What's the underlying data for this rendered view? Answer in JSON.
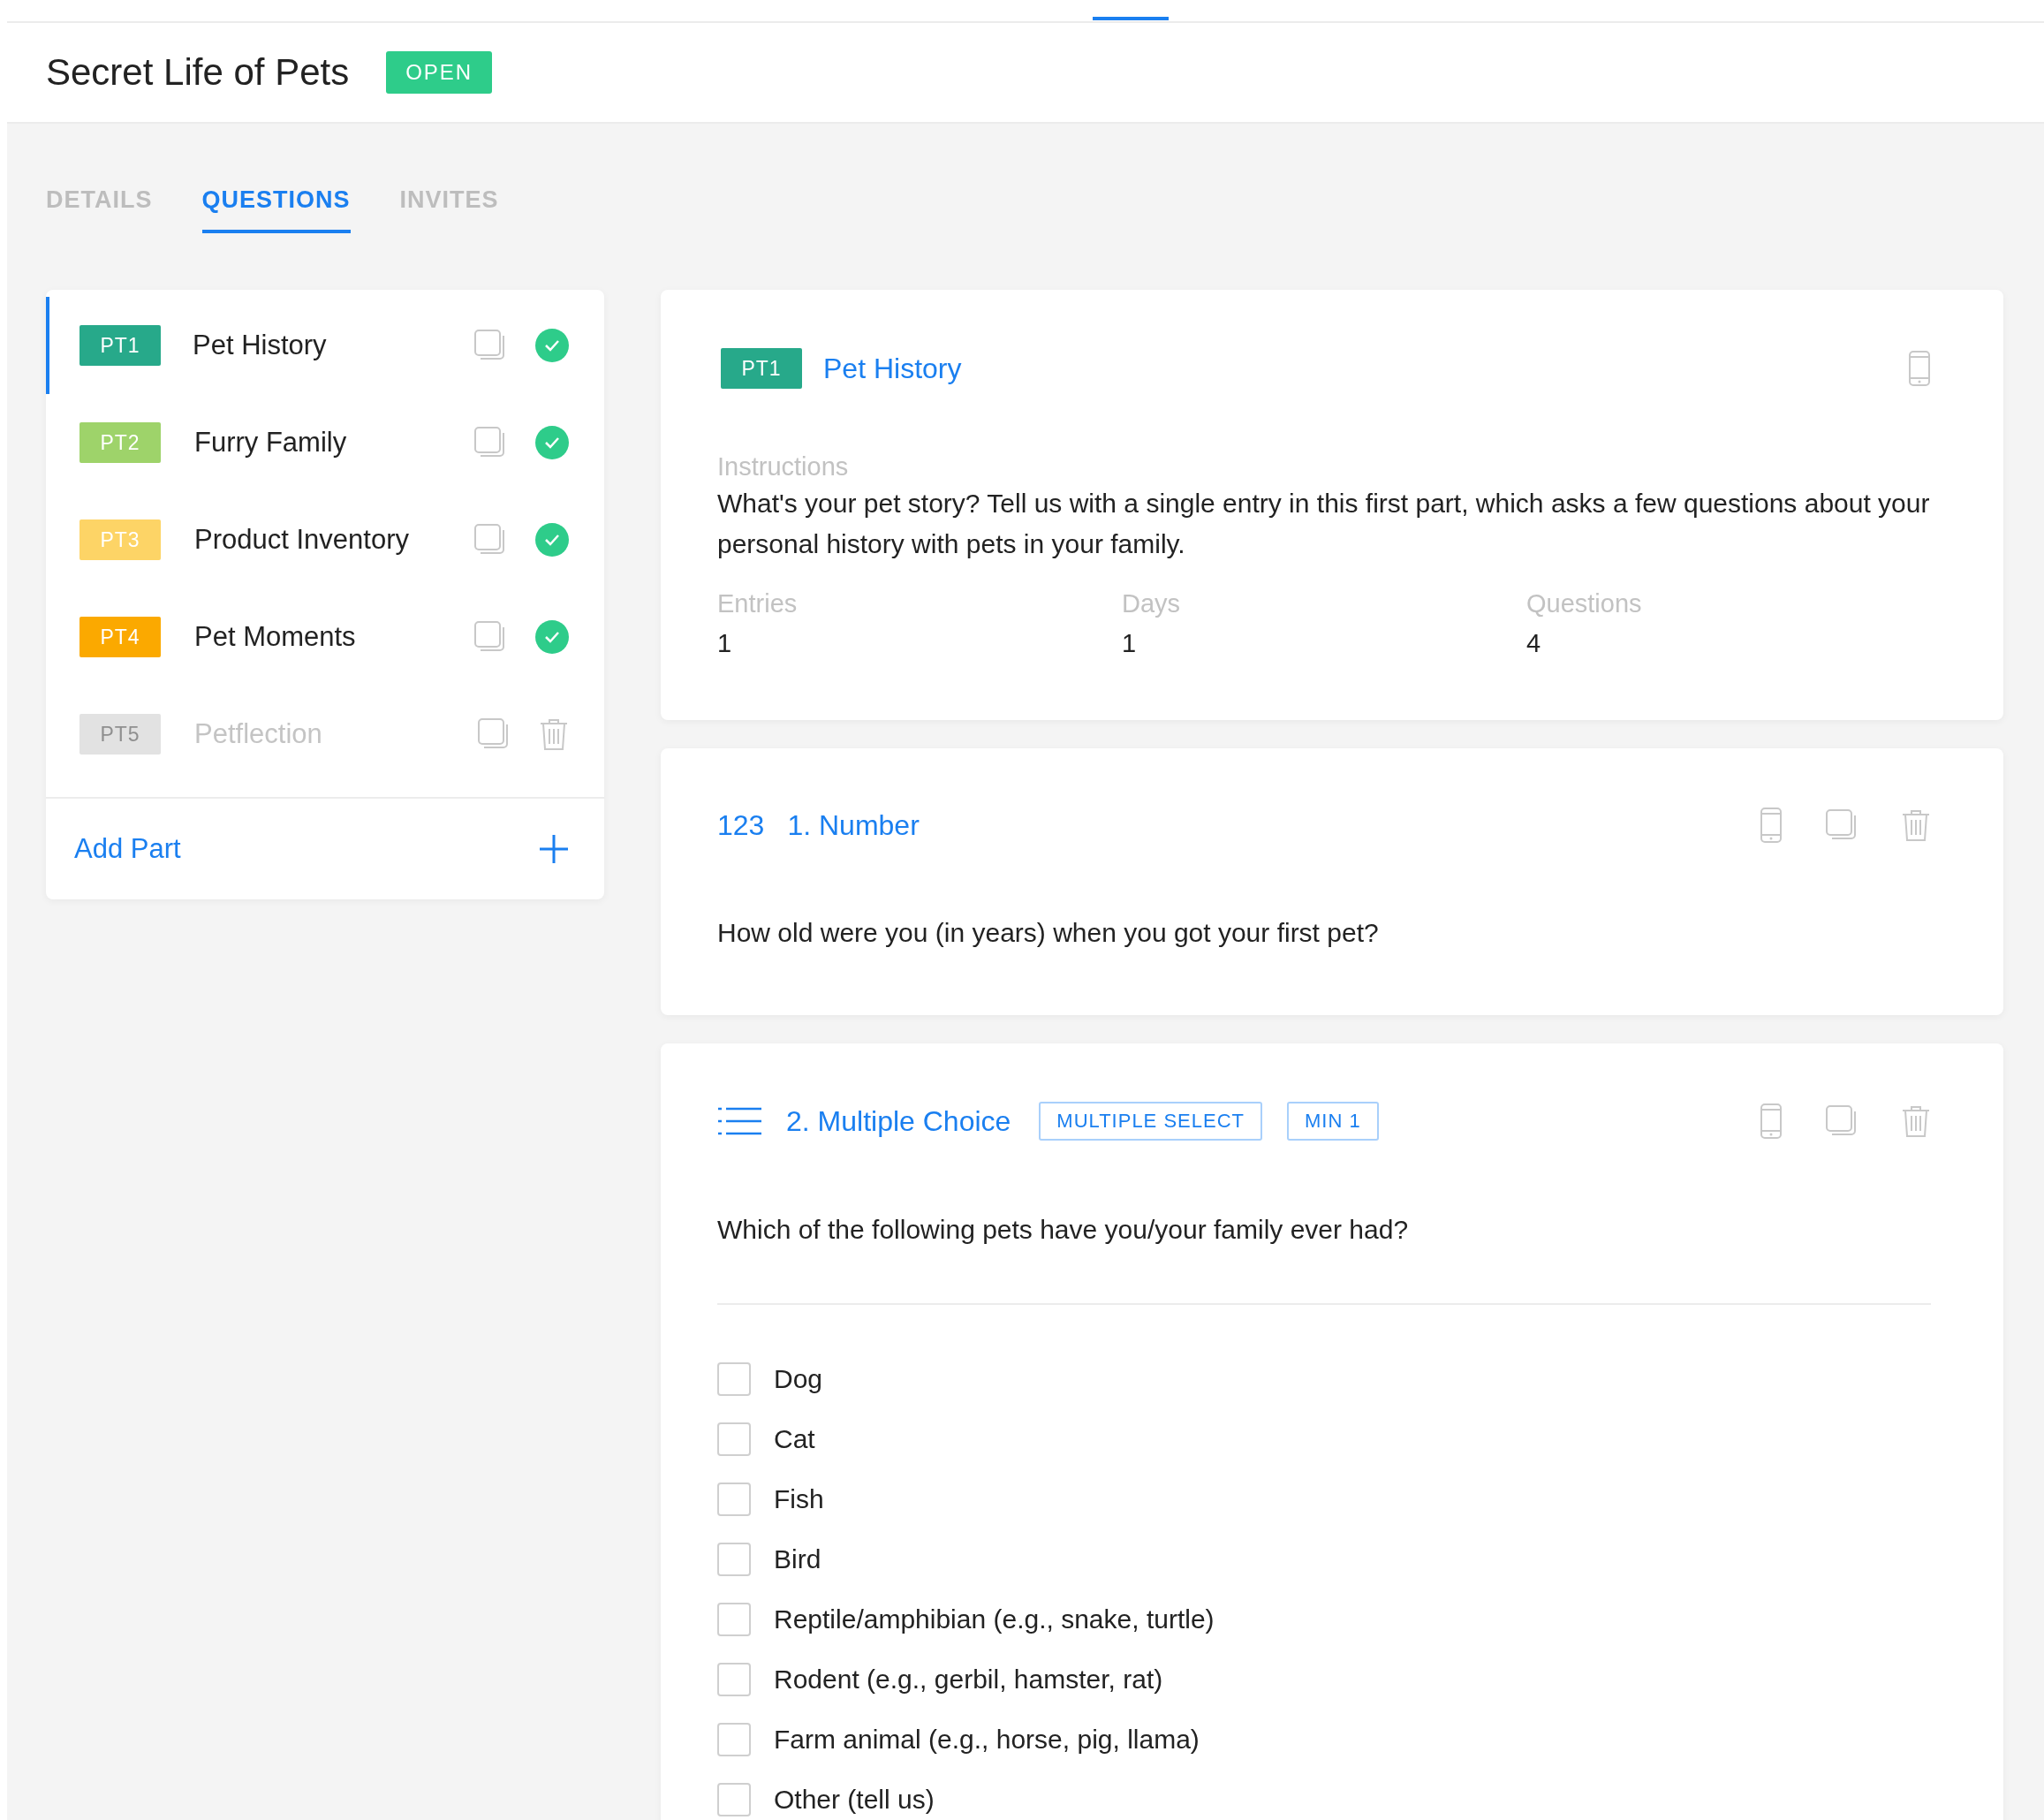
{
  "header": {
    "title": "Secret Life of Pets",
    "status": "OPEN"
  },
  "tabs": [
    {
      "label": "DETAILS",
      "selected": false
    },
    {
      "label": "QUESTIONS",
      "selected": true
    },
    {
      "label": "INVITES",
      "selected": false
    }
  ],
  "parts": [
    {
      "code": "PT1",
      "name": "Pet History",
      "color": "#27a98a",
      "selected": true,
      "disabled": false,
      "kind": "done"
    },
    {
      "code": "PT2",
      "name": "Furry Family",
      "color": "#9ed36a",
      "selected": false,
      "disabled": false,
      "kind": "done"
    },
    {
      "code": "PT3",
      "name": "Product Inventory",
      "color": "#fdd466",
      "selected": false,
      "disabled": false,
      "kind": "done"
    },
    {
      "code": "PT4",
      "name": "Pet Moments",
      "color": "#fba900",
      "selected": false,
      "disabled": false,
      "kind": "done"
    },
    {
      "code": "PT5",
      "name": "Petflection",
      "color": "#e2e2e2",
      "selected": false,
      "disabled": true,
      "kind": "deletable"
    }
  ],
  "add_part": "Add Part",
  "part_detail": {
    "code": "PT1",
    "color": "#27a98a",
    "name": "Pet History",
    "instructions_label": "Instructions",
    "instructions": "What's your pet story? Tell us with a single entry in this first part, which asks a few questions about your personal history with pets in your family.",
    "stats": [
      {
        "label": "Entries",
        "value": "1"
      },
      {
        "label": "Days",
        "value": "1"
      },
      {
        "label": "Questions",
        "value": "4"
      }
    ]
  },
  "questions": [
    {
      "kind": "number",
      "type_label": "123",
      "title": "1. Number",
      "text": "How old were you (in years) when you got your first pet?"
    },
    {
      "kind": "multiple_choice",
      "title": "2. Multiple Choice",
      "tags": [
        "MULTIPLE SELECT",
        "MIN 1"
      ],
      "text": "Which of the following pets have you/your family ever had?",
      "options": [
        {
          "label": "Dog",
          "checked": false
        },
        {
          "label": "Cat",
          "checked": false
        },
        {
          "label": "Fish",
          "checked": false
        },
        {
          "label": "Bird",
          "checked": false
        },
        {
          "label": "Reptile/amphibian (e.g., snake, turtle)",
          "checked": false
        },
        {
          "label": "Rodent (e.g., gerbil, hamster, rat)",
          "checked": false
        },
        {
          "label": "Farm animal (e.g., horse, pig, llama)",
          "checked": false
        },
        {
          "label": "Other (tell us)",
          "checked": false
        }
      ]
    }
  ]
}
